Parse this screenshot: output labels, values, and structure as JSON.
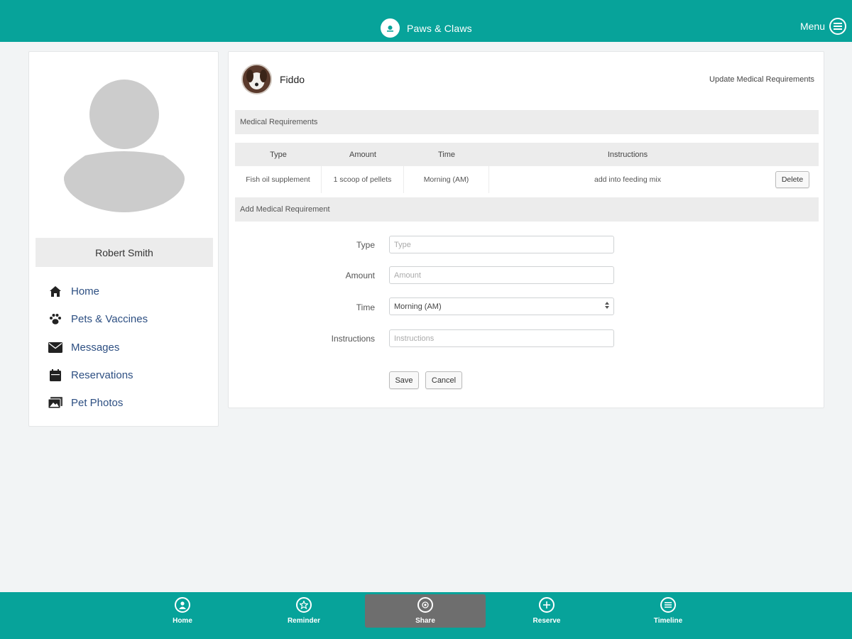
{
  "header": {
    "app_name": "Paws & Claws",
    "menu_label": "Menu"
  },
  "sidebar": {
    "user_name": "Robert Smith",
    "items": [
      {
        "label": "Home",
        "icon": "home-icon"
      },
      {
        "label": "Pets & Vaccines",
        "icon": "paw-icon"
      },
      {
        "label": "Messages",
        "icon": "envelope-icon"
      },
      {
        "label": "Reservations",
        "icon": "calendar-icon"
      },
      {
        "label": "Pet Photos",
        "icon": "photos-icon"
      }
    ]
  },
  "pet": {
    "name": "Fiddo",
    "update_link": "Update Medical Requirements"
  },
  "medical": {
    "section_title": "Medical Requirements",
    "columns": [
      "Type",
      "Amount",
      "Time",
      "Instructions"
    ],
    "rows": [
      {
        "type": "Fish oil supplement",
        "amount": "1 scoop of pellets",
        "time": "Morning (AM)",
        "instructions": "add into feeding mix",
        "action": "Delete"
      }
    ]
  },
  "form": {
    "section_title": "Add Medical Requirement",
    "type_label": "Type",
    "type_placeholder": "Type",
    "amount_label": "Amount",
    "amount_placeholder": "Amount",
    "time_label": "Time",
    "time_value": "Morning (AM)",
    "instructions_label": "Instructions",
    "instructions_placeholder": "Instructions",
    "save_label": "Save",
    "cancel_label": "Cancel"
  },
  "bottom_nav": {
    "tabs": [
      {
        "label": "Home",
        "icon": "user-circle-icon"
      },
      {
        "label": "Reminder",
        "icon": "star-icon"
      },
      {
        "label": "Share",
        "icon": "share-icon",
        "active": true
      },
      {
        "label": "Reserve",
        "icon": "plus-circle-icon"
      },
      {
        "label": "Timeline",
        "icon": "timeline-icon"
      }
    ]
  },
  "colors": {
    "brand": "#07a39a",
    "nav_link": "#2d4f82",
    "active_tab": "#6e6e6e",
    "panel_header": "#ececec"
  }
}
